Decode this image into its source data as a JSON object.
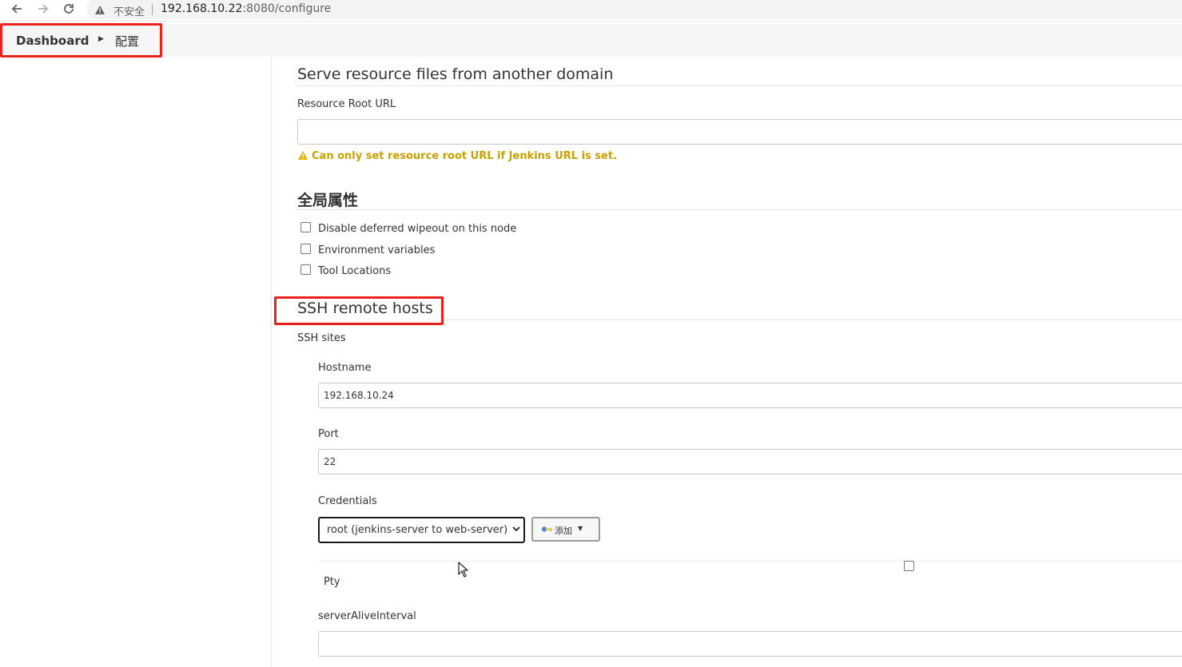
{
  "browser": {
    "insecure_label": "不安全",
    "url_host": "192.168.10.22",
    "url_path": ":8080/configure"
  },
  "breadcrumb": {
    "items": [
      "Dashboard",
      "配置"
    ]
  },
  "resource_section": {
    "title": "Serve resource files from another domain",
    "root_url_label": "Resource Root URL",
    "root_url_value": "",
    "warning": "Can only set resource root URL if Jenkins URL is set."
  },
  "global_properties": {
    "title": "全局属性",
    "options": [
      {
        "label": "Disable deferred wipeout on this node",
        "checked": false
      },
      {
        "label": "Environment variables",
        "checked": false
      },
      {
        "label": "Tool Locations",
        "checked": false
      }
    ]
  },
  "ssh_section": {
    "title": "SSH remote hosts",
    "sites_label": "SSH sites",
    "hostname_label": "Hostname",
    "hostname_value": "192.168.10.24",
    "port_label": "Port",
    "port_value": "22",
    "credentials_label": "Credentials",
    "credentials_selected": "root (jenkins-server to web-server)",
    "add_button": "添加",
    "pty_label": "Pty",
    "pty_checked": false,
    "server_alive_label": "serverAliveInterval",
    "server_alive_value": ""
  },
  "colors": {
    "highlight": "#e8221c",
    "warning": "#c9a000"
  }
}
